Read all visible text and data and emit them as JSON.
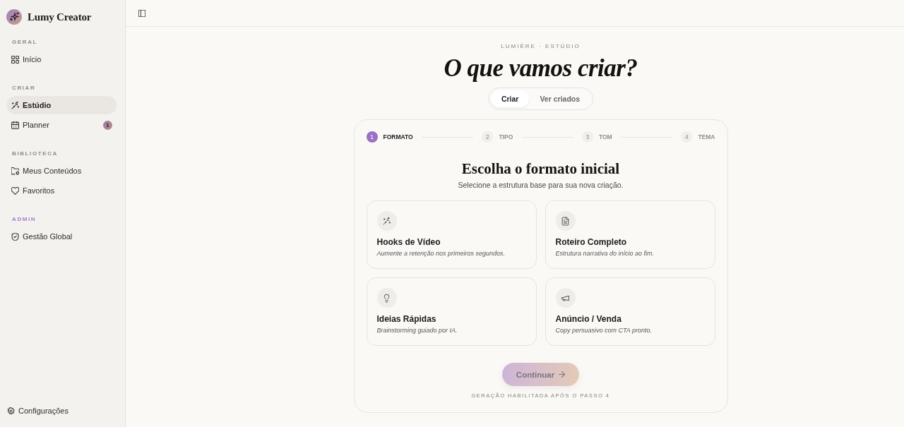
{
  "app": {
    "name": "Lumy Creator"
  },
  "sidebar": {
    "sections": [
      {
        "title": "GERAL",
        "color": "#8f8a84",
        "items": [
          {
            "label": "Início",
            "selected": false
          }
        ]
      },
      {
        "title": "CRIAR",
        "color": "#8f8a84",
        "items": [
          {
            "label": "Estúdio",
            "selected": true
          },
          {
            "label": "Planner",
            "selected": false,
            "badge": "1"
          }
        ]
      },
      {
        "title": "BIBLIOTECA",
        "color": "#8f8a84",
        "items": [
          {
            "label": "Meus Conteúdos",
            "selected": false
          },
          {
            "label": "Favoritos",
            "selected": false
          }
        ]
      },
      {
        "title": "ADMIN",
        "color": "#a67cc9",
        "items": [
          {
            "label": "Gestão Global",
            "selected": false
          }
        ]
      }
    ],
    "footer": {
      "label": "Configurações"
    }
  },
  "header": {
    "eyebrow": "LUMIÈRE · ESTÚDIO",
    "title": "O que vamos criar?",
    "view_tabs": [
      {
        "label": "Criar",
        "selected": true
      },
      {
        "label": "Ver criados",
        "selected": false
      }
    ]
  },
  "wizard": {
    "steps": [
      {
        "number": "1",
        "label": "FORMATO",
        "selected": true
      },
      {
        "number": "2",
        "label": "TIPO",
        "selected": false
      },
      {
        "number": "3",
        "label": "TOM",
        "selected": false
      },
      {
        "number": "4",
        "label": "TEMA",
        "selected": false
      }
    ],
    "heading": "Escolha o formato inicial",
    "subheading": "Selecione a estrutura base para sua nova criação.",
    "formats": [
      {
        "title": "Hooks de Vídeo",
        "description": "Aumente a retenção nos primeiros segundos.",
        "selected": false
      },
      {
        "title": "Roteiro Completo",
        "description": "Estrutura narrativa do início ao fim.",
        "selected": false
      },
      {
        "title": "Ideias Rápidas",
        "description": "Brainstorming guiado por IA.",
        "selected": false
      },
      {
        "title": "Anúncio / Venda",
        "description": "Copy persuasivo com CTA pronto.",
        "selected": false
      }
    ],
    "continue_button": {
      "label": "Continuar",
      "disabled": true
    },
    "hint": "GERAÇÃO HABILITADA APÓS O PASSO 4"
  }
}
